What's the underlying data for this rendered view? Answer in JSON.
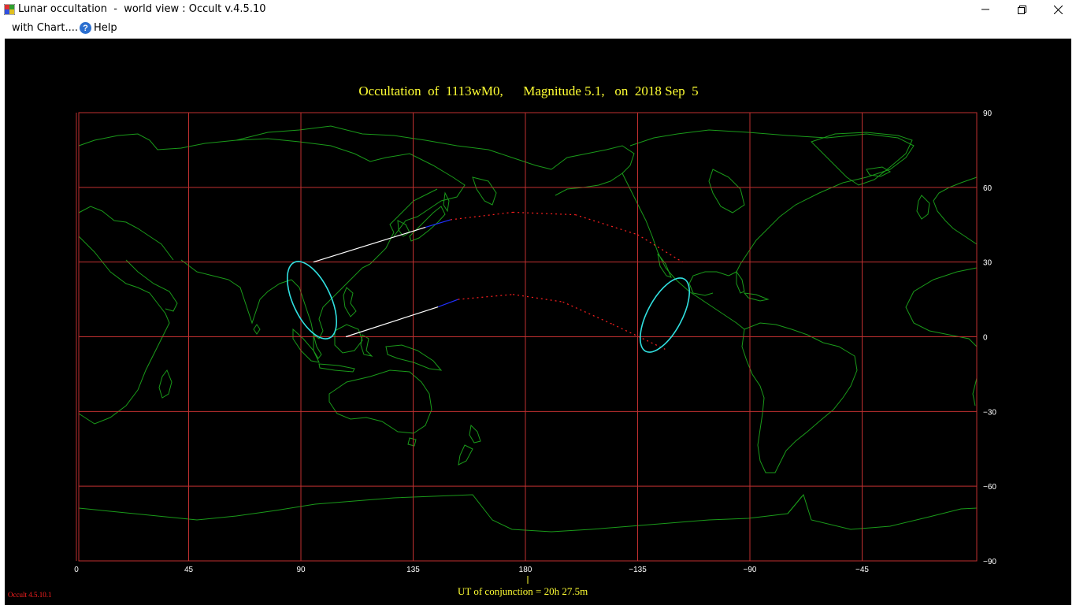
{
  "window": {
    "title": "Lunar occultation  -  world view : Occult v.4.5.10",
    "minimize_icon": "minimize-icon",
    "maximize_icon": "restore-icon",
    "close_icon": "close-icon"
  },
  "menu": {
    "items": [
      {
        "label": "with Chart....",
        "icon": ""
      },
      {
        "label": "Help",
        "icon": "help-icon"
      }
    ]
  },
  "chart": {
    "title": "Occultation  of  1113wM0,      Magnitude 5.1,   on  2018 Sep  5",
    "ut_label": "UT of conjunction = 20h 27.5m",
    "version": "Occult 4.5.10.1",
    "colors": {
      "background": "#000000",
      "grid": "#c03030",
      "coast": "#1a9a1a",
      "limit": "#30e0e0",
      "track_day": "#ffffff",
      "track_twilight": "#2030ff",
      "track_night": "#ff2020",
      "text": "#ffff33"
    }
  },
  "chart_data": {
    "type": "map",
    "projection": "equirectangular",
    "center_longitude": 180,
    "x_ticks": [
      45,
      90,
      135,
      180,
      -135,
      -90,
      -45,
      0
    ],
    "x_tick_labels": [
      "45",
      "90",
      "135",
      "180",
      "−135",
      "−90",
      "−45",
      "0"
    ],
    "y_ticks": [
      90,
      60,
      30,
      0,
      -30,
      -60,
      -90
    ],
    "y_tick_labels": [
      "90",
      "60",
      "30",
      "0",
      "−30",
      "−60",
      "−90"
    ],
    "north_limit": [
      [
        95,
        30
      ],
      [
        140,
        44
      ],
      [
        150,
        47
      ],
      [
        175,
        50
      ],
      [
        200,
        49
      ],
      [
        225,
        41
      ],
      [
        243,
        30
      ]
    ],
    "south_limit": [
      [
        108,
        0
      ],
      [
        145,
        12
      ],
      [
        153,
        15
      ],
      [
        175,
        17
      ],
      [
        195,
        14
      ],
      [
        215,
        5
      ],
      [
        236,
        -5
      ]
    ],
    "conjunction_longitude": 193
  }
}
